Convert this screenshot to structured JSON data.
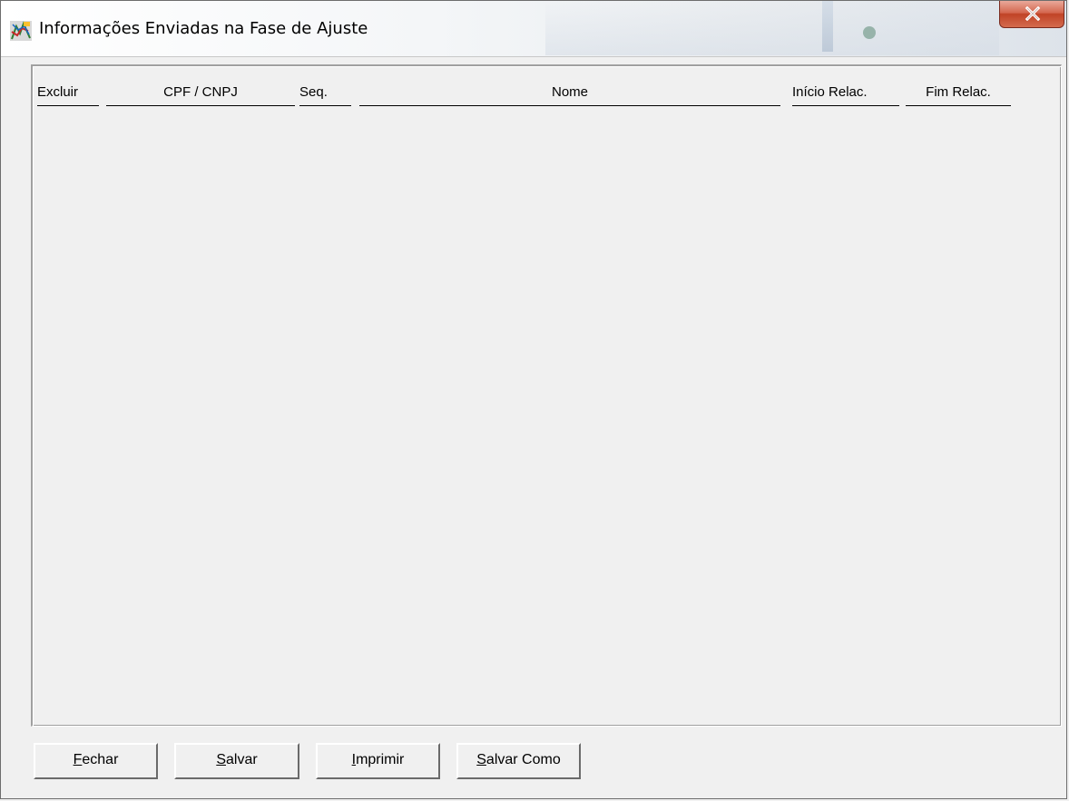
{
  "window": {
    "title": "Informações Enviadas na Fase de Ajuste",
    "close_icon": "close-x-icon"
  },
  "table": {
    "headers": {
      "excluir": "Excluir",
      "cpf_cnpj": "CPF / CNPJ",
      "seq": "Seq.",
      "nome": "Nome",
      "inicio_relac": "Início Relac.",
      "fim_relac": "Fim Relac."
    },
    "rows": []
  },
  "buttons": {
    "fechar": {
      "mnemonic": "F",
      "rest": "echar"
    },
    "salvar": {
      "mnemonic": "S",
      "rest": "alvar"
    },
    "imprimir": {
      "mnemonic": "I",
      "rest": "mprimir"
    },
    "salvar_como": {
      "mnemonic": "S",
      "rest": "alvar Como"
    }
  },
  "colors": {
    "close_button": "#c04326",
    "window_bg": "#f0f0f0"
  }
}
